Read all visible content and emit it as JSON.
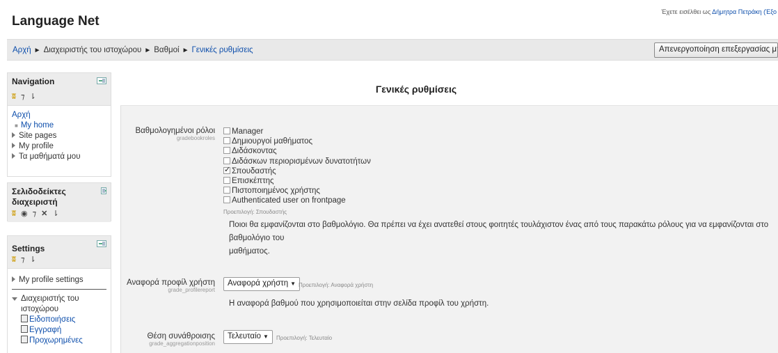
{
  "header": {
    "site_title": "Language Net",
    "login_prefix": "Έχετε εισέλθει ως ",
    "login_user": "Δήμητρα Πετράκη (Έξο"
  },
  "navbar": {
    "breadcrumb": [
      "Αρχή",
      "Διαχειριστής του ιστοχώρου",
      "Βαθμοί",
      "Γενικές ρυθμίσεις"
    ],
    "separator": "►",
    "edit_button": "Απενεργοποίηση επεξεργασίας μπλ"
  },
  "navigation_block": {
    "title": "Navigation",
    "home": "Αρχή",
    "items": [
      {
        "label": "My home",
        "marker": "bullet"
      },
      {
        "label": "Site pages",
        "marker": "arrow"
      },
      {
        "label": "My profile",
        "marker": "arrow"
      },
      {
        "label": "Τα μαθήματά μου",
        "marker": "arrow"
      }
    ]
  },
  "bookmarks_block": {
    "title_line1": "Σελιδοδείκτες",
    "title_line2": "διαχειριστή"
  },
  "settings_block": {
    "title": "Settings",
    "items": [
      "My profile settings"
    ],
    "admin_label_line1": "Διαχειριστής του",
    "admin_label_line2": "ιστοχώρου",
    "sub_items": [
      "Ειδοποιήσεις",
      "Εγγραφή",
      "Προχωρημένες"
    ]
  },
  "main": {
    "title": "Γενικές ρυθμίσεις",
    "gradebookroles": {
      "label": "Βαθμολογημένοι ρόλοι",
      "name": "gradebookroles",
      "options": [
        {
          "label": "Manager",
          "checked": false
        },
        {
          "label": "Δημιουργοί μαθήματος",
          "checked": false
        },
        {
          "label": "Διδάσκοντας",
          "checked": false
        },
        {
          "label": "Διδάσκων περιορισμένων δυνατοτήτων",
          "checked": false
        },
        {
          "label": "Σπουδαστής",
          "checked": true
        },
        {
          "label": "Επισκέπτης",
          "checked": false
        },
        {
          "label": "Πιστοποιημένος χρήστης",
          "checked": false
        },
        {
          "label": "Authenticated user on frontpage",
          "checked": false
        }
      ],
      "default": "Προεπιλογή: Σπουδαστής",
      "description_line1": "Ποιοι θα εμφανίζονται στο βαθμολόγιο. Θα πρέπει να έχει ανατεθεί στους φοιτητές τουλάχιστον ένας από τους παρακάτω ρόλους για να εμφανίζονται στο βαθμολόγιο του",
      "description_line2": "μαθήματος."
    },
    "profilereport": {
      "label": "Αναφορά προφίλ χρήστη",
      "name": "grade_profilereport",
      "value": "Αναφορά χρήστη",
      "default": "Προεπιλογή: Αναφορά χρήστη",
      "description": "Η αναφορά βαθμού που χρησιμοποιείται στην σελίδα προφίλ του χρήστη."
    },
    "aggregationposition": {
      "label": "Θέση συνάθροισης",
      "name": "grade_aggregationposition",
      "value": "Τελευταίο",
      "default": "Προεπιλογή: Τελευταίο"
    }
  }
}
